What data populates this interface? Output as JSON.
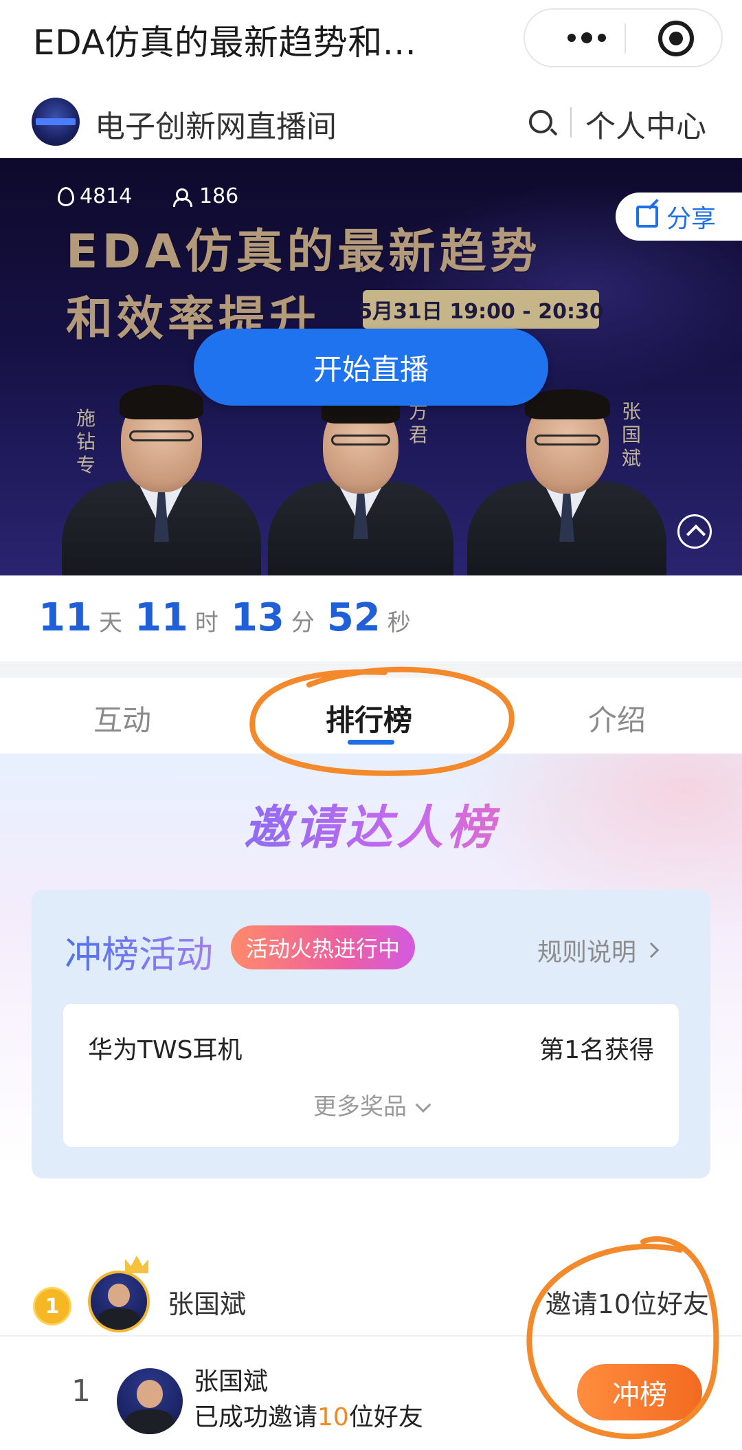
{
  "topbar": {
    "title": "EDA仿真的最新趋势和...",
    "more_icon": "more-dots-icon",
    "close_icon": "target-circle-icon"
  },
  "channel": {
    "logo_icon": "channel-logo",
    "name": "电子创新网直播间",
    "search_icon": "search-icon",
    "personal_center": "个人中心"
  },
  "banner": {
    "hot_count": "4814",
    "viewer_count": "186",
    "share_label": "分享",
    "title_line1": "EDA仿真的最新趋势",
    "title_line2": "和效率提升",
    "date_time": "5月31日 19:00 - 20:30",
    "start_live_label": "开始直播",
    "speakers": [
      "施钻专",
      "方君",
      "张国斌"
    ]
  },
  "countdown": {
    "days": "11",
    "days_unit": "天",
    "hours": "11",
    "hours_unit": "时",
    "minutes": "13",
    "minutes_unit": "分",
    "seconds": "52",
    "seconds_unit": "秒"
  },
  "tabs": [
    {
      "label": "互动",
      "active": false
    },
    {
      "label": "排行榜",
      "active": true
    },
    {
      "label": "介绍",
      "active": false
    }
  ],
  "ranking": {
    "title": "邀请达人榜",
    "activity_title": "冲榜活动",
    "hot_badge": "活动火热进行中",
    "rules_label": "规则说明",
    "prize": {
      "name": "华为TWS耳机",
      "rank": "第1名获得"
    },
    "more_prizes": "更多奖品"
  },
  "leaderboard": [
    {
      "rank": "1",
      "name": "张国斌",
      "invite_text": "邀请10位好友"
    }
  ],
  "my_row": {
    "rank": "1",
    "name": "张国斌",
    "status_prefix": "已成功邀请",
    "status_count": "10",
    "status_suffix": "位好友",
    "rush_label": "冲榜"
  },
  "colors": {
    "accent_blue": "#1f6fe6",
    "countdown_blue": "#1f5fd8",
    "orange": "#f26a1f",
    "annotation_orange": "#f4892c"
  }
}
